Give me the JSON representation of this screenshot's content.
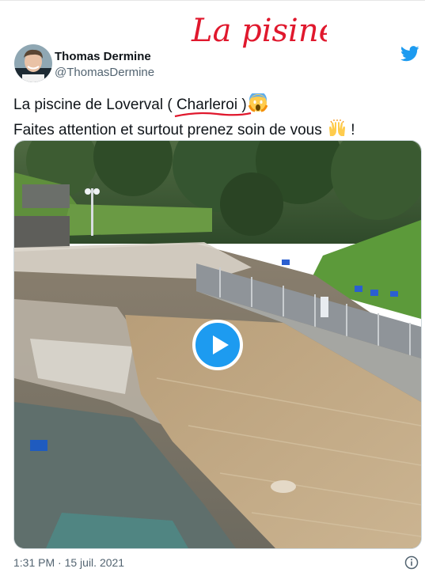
{
  "handwritten_note": "La pisine",
  "author": {
    "name": "Thomas Dermine",
    "handle": "@ThomasDermine"
  },
  "tweet": {
    "line1_prefix": "La piscine de Loverval ( ",
    "line1_highlight": "Charleroi",
    "line1_suffix": " )",
    "line2_prefix": "Faites attention et surtout prenez soin de vous",
    "line2_suffix": " !",
    "emoji1": "screaming-face",
    "emoji2": "raising-hands"
  },
  "timestamp": "1:31 PM · 15 juil. 2021",
  "colors": {
    "accent": "#1d9bf0",
    "annotation": "#e0182d"
  },
  "icons": [
    "twitter-bird-icon",
    "play-icon",
    "info-icon"
  ]
}
